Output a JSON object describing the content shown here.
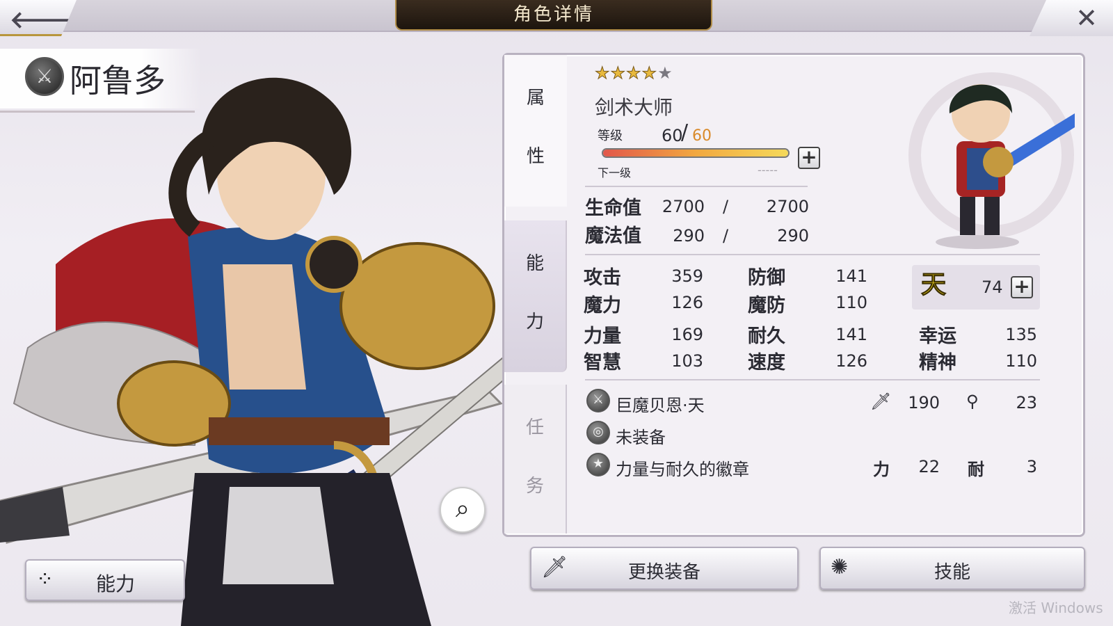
{
  "header": {
    "title": "角色详情",
    "back_icon": "left-arrow",
    "close_icon": "close-x"
  },
  "character": {
    "name": "阿鲁多",
    "class_icon": "sword-emblem",
    "rarity_filled": 4,
    "rarity_total": 5,
    "job": "剑术大师",
    "level": {
      "label": "等级",
      "current": "60",
      "max": "60",
      "progress": 1.0,
      "next_label": "下一级",
      "next_value": "-----"
    },
    "hp": {
      "label": "生命值",
      "current": "2700",
      "max": "2700"
    },
    "mp": {
      "label": "魔法值",
      "current": "290",
      "max": "290"
    }
  },
  "tabs": [
    {
      "chars": [
        "属",
        "性"
      ]
    },
    {
      "chars": [
        "能",
        "力"
      ]
    },
    {
      "chars": [
        "任",
        "务"
      ]
    }
  ],
  "stats": {
    "attack": {
      "label": "攻击",
      "value": "359"
    },
    "defense": {
      "label": "防御",
      "value": "141"
    },
    "magic": {
      "label": "魔力",
      "value": "126"
    },
    "mdef": {
      "label": "魔防",
      "value": "110"
    },
    "strength": {
      "label": "力量",
      "value": "169"
    },
    "endurance": {
      "label": "耐久",
      "value": "141"
    },
    "luck": {
      "label": "幸运",
      "value": "135"
    },
    "wisdom": {
      "label": "智慧",
      "value": "103"
    },
    "speed": {
      "label": "速度",
      "value": "126"
    },
    "spirit": {
      "label": "精神",
      "value": "110"
    },
    "heaven": {
      "glyph": "天",
      "value": "74"
    }
  },
  "equipment": [
    {
      "icon": "sword-icon",
      "name": "巨魔贝恩·天",
      "stat1_icon": "sword",
      "stat1_value": "190",
      "stat2_icon": "staff",
      "stat2_value": "23"
    },
    {
      "icon": "accessory-icon",
      "name": "未装备"
    },
    {
      "icon": "badge-icon",
      "name": "力量与耐久的徽章",
      "stat1_label": "力",
      "stat1_value": "22",
      "stat2_label": "耐",
      "stat2_value": "3"
    }
  ],
  "buttons": {
    "ability": "能力",
    "equip": "更换装备",
    "skill": "技能"
  },
  "watermark": "激活 Windows"
}
